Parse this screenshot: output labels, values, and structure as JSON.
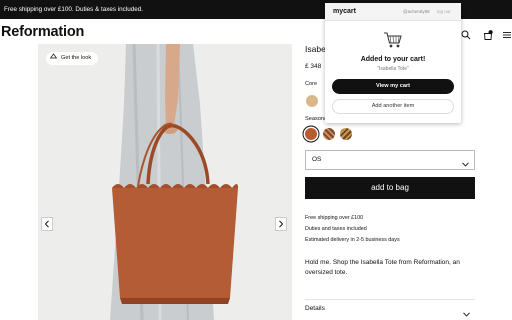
{
  "topbar": {
    "shipping_text": "Free shipping over £100. Duties & taxes included."
  },
  "header": {
    "logo": "Reformation",
    "icons": [
      "search-icon",
      "bag-icon",
      "menu-icon"
    ],
    "bag_count": "0"
  },
  "gallery": {
    "get_the_look": "Get the look",
    "left_arrow": "‹",
    "right_arrow": "›"
  },
  "product": {
    "title": "Isabella Tote",
    "price": "£ 348",
    "core_label": "Core",
    "seasonal_label": "Seasonal",
    "size_value": "OS",
    "add_to_bag": "add to bag",
    "info": [
      "Free shipping over £100",
      "Duties and taxes included",
      "Estimated delivery in 2-5 business days"
    ],
    "description": "Hold me. Shop the Isabella Tote from Reformation, an oversized tote.",
    "details_label": "Details",
    "colors": {
      "core": "#d9b98a",
      "seasonal_1": "#b95a31",
      "seasonal_2": "#7a4a2a",
      "seasonal_3": "#c9974f"
    }
  },
  "popup": {
    "brand": "mycart",
    "handle": "@acheraly88",
    "logout": "log out",
    "added": "Added to your cart!",
    "item": "\"Isabella Tote\"",
    "view_cart": "View my cart",
    "add_another": "Add another item"
  },
  "colors": {
    "accent": "#111111",
    "bag": "#b35c35",
    "gallery_bg": "#ededeb"
  }
}
